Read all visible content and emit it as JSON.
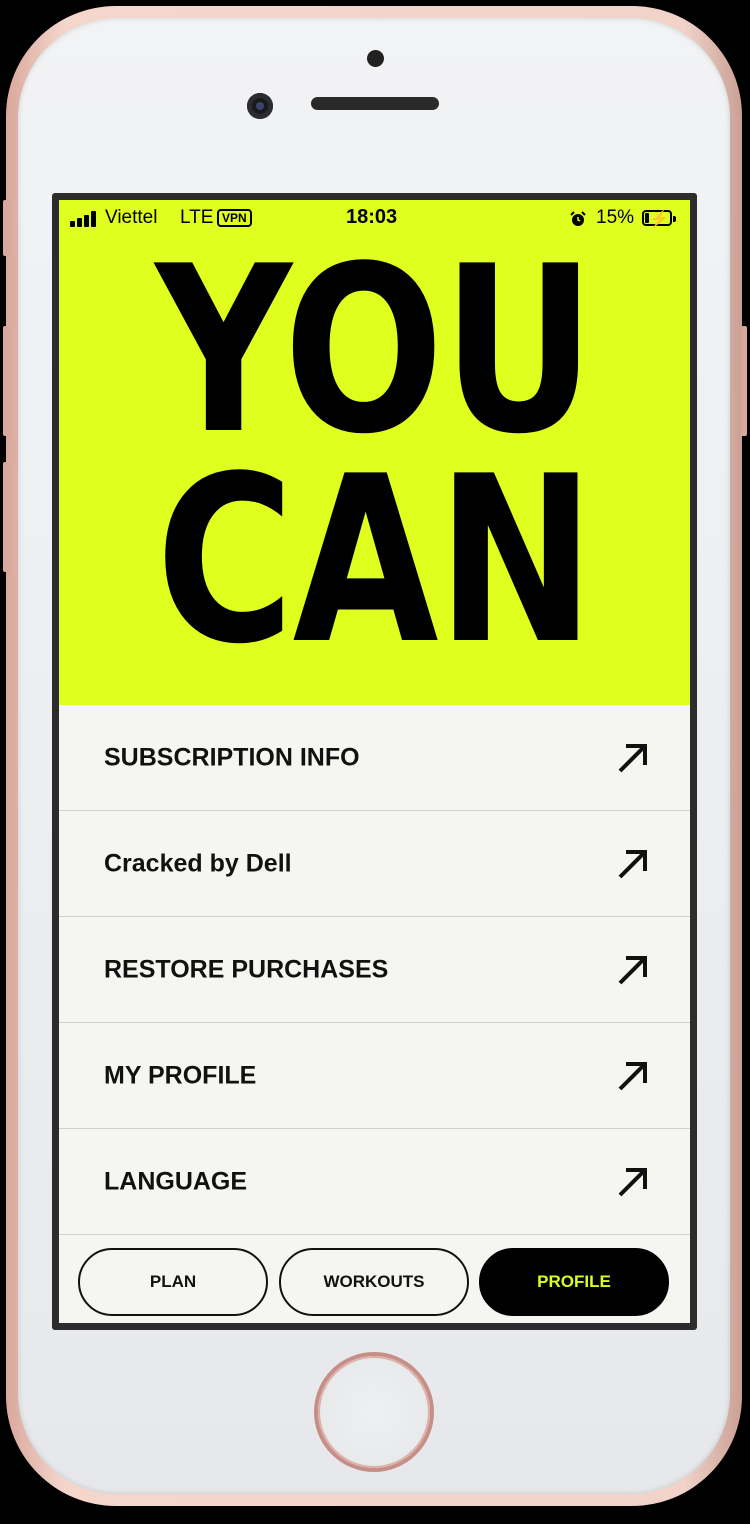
{
  "status_bar": {
    "carrier": "Viettel",
    "network": "LTE",
    "vpn": "VPN",
    "time": "18:03",
    "battery": "15%",
    "battery_level_percent": 15
  },
  "hero": {
    "line1": "YOU",
    "line2": "CAN",
    "background_color": "#dfff1f"
  },
  "menu": {
    "items": [
      {
        "label": "SUBSCRIPTION INFO",
        "icon": "arrow-up-right-icon"
      },
      {
        "label": "Cracked by Dell",
        "icon": "arrow-up-right-icon"
      },
      {
        "label": "RESTORE PURCHASES",
        "icon": "arrow-up-right-icon"
      },
      {
        "label": "MY PROFILE",
        "icon": "arrow-up-right-icon"
      },
      {
        "label": "LANGUAGE",
        "icon": "arrow-up-right-icon"
      }
    ]
  },
  "tabs": [
    {
      "label": "PLAN",
      "active": false
    },
    {
      "label": "WORKOUTS",
      "active": false
    },
    {
      "label": "PROFILE",
      "active": true
    }
  ],
  "colors": {
    "accent": "#dfff1f",
    "active_tab_bg": "#000000",
    "active_tab_text": "#d9ff1f"
  }
}
